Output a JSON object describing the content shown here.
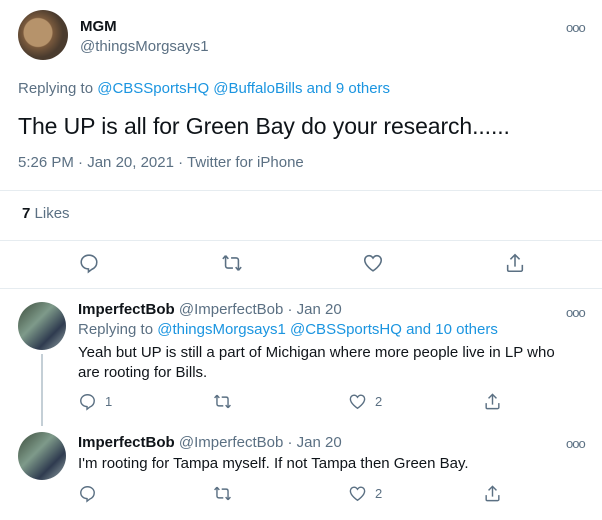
{
  "main_tweet": {
    "display_name": "MGM",
    "handle": "@thingsMorgsays1",
    "replying_prefix": "Replying to",
    "replying_users": "@CBSSportsHQ @BuffaloBills",
    "replying_and": "and",
    "replying_others": "9 others",
    "text": "The UP is all for Green Bay do your research......",
    "time": "5:26 PM",
    "date": "Jan 20, 2021",
    "source": "Twitter for iPhone",
    "likes_count": "7",
    "likes_label": "Likes",
    "more_icon": "more-dots-icon"
  },
  "replies": [
    {
      "display_name": "ImperfectBob",
      "handle": "@ImperfectBob",
      "date": "Jan 20",
      "replying_prefix": "Replying to",
      "replying_users": "@thingsMorgsays1 @CBSSportsHQ",
      "replying_and": "and",
      "replying_others": "10 others",
      "text_line1": "Yeah but UP is still a part of Michigan where more people live in LP who",
      "text_line2": "are rooting for Bills.",
      "reply_count": "1",
      "retweet_count": "",
      "like_count": "2"
    },
    {
      "display_name": "ImperfectBob",
      "handle": "@ImperfectBob",
      "date": "Jan 20",
      "text_line1": "I'm rooting for Tampa myself. If not Tampa then Green Bay.",
      "reply_count": "",
      "retweet_count": "",
      "like_count": "2"
    }
  ],
  "separator": "·",
  "colors": {
    "link": "#1b95e0",
    "secondary": "#5b7083",
    "divider": "#e6ecf0"
  }
}
